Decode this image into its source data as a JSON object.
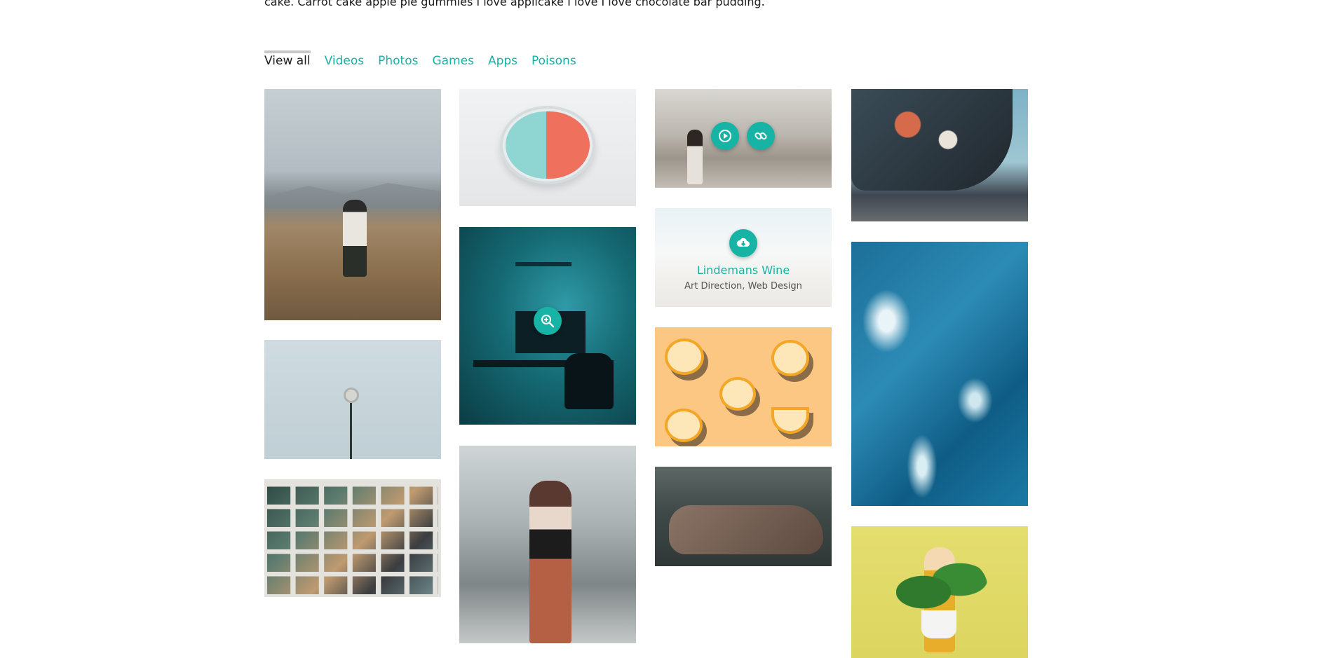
{
  "intro": {
    "text": "cake. Carrot cake apple pie gummies I love applicake I love I love chocolate bar pudding."
  },
  "filters": [
    {
      "label": "View all",
      "active": true
    },
    {
      "label": "Videos",
      "active": false
    },
    {
      "label": "Photos",
      "active": false
    },
    {
      "label": "Games",
      "active": false
    },
    {
      "label": "Apps",
      "active": false
    },
    {
      "label": "Poisons",
      "active": false
    }
  ],
  "portfolio": {
    "featured_title": "Lindemans Wine",
    "featured_subtitle": "Art Direction, Web Design"
  },
  "colors": {
    "accent": "#17b3a5",
    "active_filter": "#1e1e1e"
  },
  "icons": {
    "play": "play-icon",
    "link": "link-icon",
    "download": "cloud-download-icon",
    "zoom": "zoom-in-icon"
  }
}
